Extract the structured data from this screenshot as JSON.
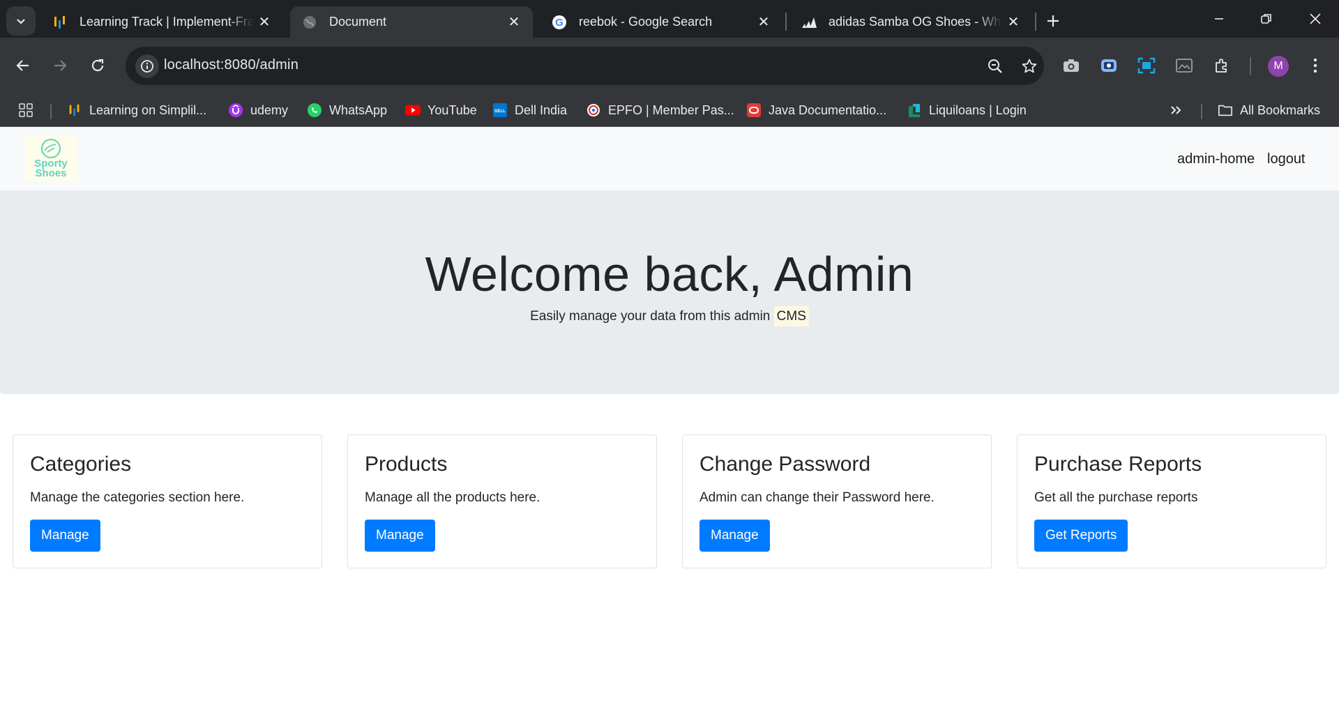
{
  "browser": {
    "tabs": [
      {
        "title": "Learning Track | Implement-Fram",
        "icon": "simplilearn-icon"
      },
      {
        "title": "Document",
        "icon": "globe-icon",
        "active": true
      },
      {
        "title": "reebok - Google Search",
        "icon": "google-icon"
      },
      {
        "title": "adidas Samba OG Shoes - White",
        "icon": "adidas-icon"
      }
    ],
    "url": "localhost:8080/admin",
    "avatar_letter": "M",
    "bookmarks": [
      {
        "label": "Learning on Simplil...",
        "icon": "simplilearn-icon"
      },
      {
        "label": "udemy",
        "icon": "udemy-icon"
      },
      {
        "label": "WhatsApp",
        "icon": "whatsapp-icon"
      },
      {
        "label": "YouTube",
        "icon": "youtube-icon"
      },
      {
        "label": "Dell India",
        "icon": "dell-icon"
      },
      {
        "label": "EPFO | Member Pas...",
        "icon": "epfo-icon"
      },
      {
        "label": "Java Documentatio...",
        "icon": "oracle-icon"
      },
      {
        "label": "Liquiloans | Login",
        "icon": "liquiloans-icon"
      }
    ],
    "all_bookmarks_label": "All Bookmarks"
  },
  "site": {
    "logo_text_1": "Sporty",
    "logo_text_2": "Shoes",
    "nav": {
      "home": "admin-home",
      "logout": "logout"
    }
  },
  "hero": {
    "title": "Welcome back, Admin",
    "subtitle": "Easily manage your data from this admin",
    "highlight": "CMS"
  },
  "cards": [
    {
      "title": "Categories",
      "text": "Manage the categories section here.",
      "button": "Manage"
    },
    {
      "title": "Products",
      "text": "Manage all the products here.",
      "button": "Manage"
    },
    {
      "title": "Change Password",
      "text": "Admin can change their Password here.",
      "button": "Manage"
    },
    {
      "title": "Purchase Reports",
      "text": "Get all the purchase reports",
      "button": "Get Reports"
    }
  ],
  "colors": {
    "primary_button": "#007bff",
    "hero_bg": "#e9ecef",
    "nav_bg": "#f8f9fa",
    "chrome_dark": "#202124",
    "chrome_mid": "#35363a"
  }
}
